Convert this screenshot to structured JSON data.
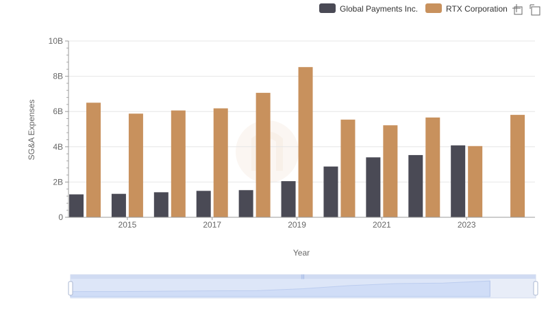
{
  "chart_data": {
    "type": "bar",
    "xlabel": "Year",
    "ylabel": "SG&A Expenses",
    "ylim": [
      0,
      10000000000
    ],
    "y_ticks": [
      {
        "value": 0,
        "label": "0"
      },
      {
        "value": 2000000000,
        "label": "2B"
      },
      {
        "value": 4000000000,
        "label": "4B"
      },
      {
        "value": 6000000000,
        "label": "6B"
      },
      {
        "value": 8000000000,
        "label": "8B"
      },
      {
        "value": 10000000000,
        "label": "10B"
      }
    ],
    "categories": [
      2014,
      2015,
      2016,
      2017,
      2018,
      2019,
      2020,
      2021,
      2022,
      2023,
      2024
    ],
    "x_tick_labels": [
      "2015",
      "2017",
      "2019",
      "2021",
      "2023"
    ],
    "grid": true,
    "legend_position": "top-right",
    "series": [
      {
        "name": "Global Payments Inc.",
        "color": "#4a4a55",
        "values": [
          1300000000,
          1330000000,
          1420000000,
          1500000000,
          1540000000,
          2050000000,
          2880000000,
          3400000000,
          3530000000,
          4080000000,
          null
        ]
      },
      {
        "name": "RTX Corporation",
        "color": "#c8915d",
        "values": [
          6500000000,
          5880000000,
          6060000000,
          6180000000,
          7060000000,
          8520000000,
          5540000000,
          5220000000,
          5660000000,
          4040000000,
          5810000000
        ]
      }
    ]
  },
  "toolbar": {
    "icons": [
      "zoom-select-icon",
      "zoom-reset-icon"
    ]
  }
}
